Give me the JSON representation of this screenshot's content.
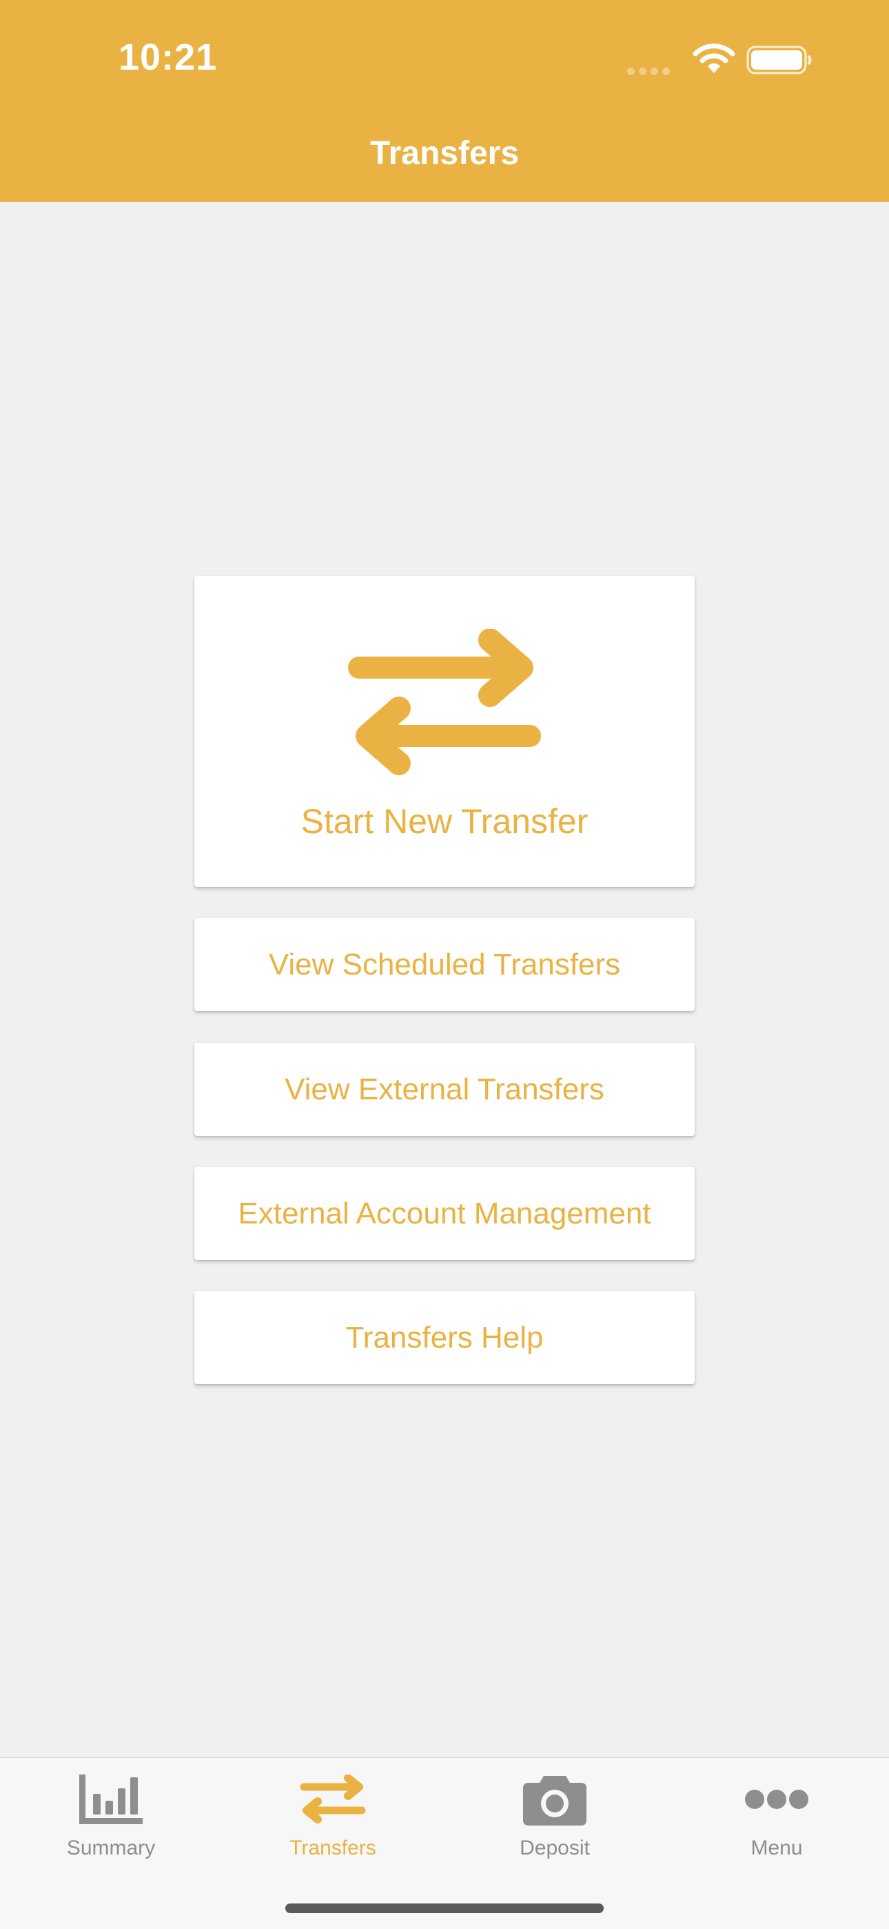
{
  "status_bar": {
    "time": "10:21"
  },
  "header": {
    "title": "Transfers"
  },
  "main": {
    "hero_button": {
      "label": "Start New Transfer",
      "icon": "transfer-arrows-icon"
    },
    "buttons": [
      {
        "label": "View Scheduled Transfers"
      },
      {
        "label": "View External Transfers"
      },
      {
        "label": "External Account Management"
      },
      {
        "label": "Transfers Help"
      }
    ]
  },
  "tab_bar": {
    "active": "Transfers",
    "tabs": [
      {
        "label": "Summary",
        "icon": "bar-chart-icon"
      },
      {
        "label": "Transfers",
        "icon": "transfer-arrows-icon"
      },
      {
        "label": "Deposit",
        "icon": "camera-icon"
      },
      {
        "label": "Menu",
        "icon": "more-dots-icon"
      }
    ]
  },
  "colors": {
    "accent": "#eab242",
    "background": "#f0f0f0",
    "inactive_tab": "#8e8e8e"
  }
}
